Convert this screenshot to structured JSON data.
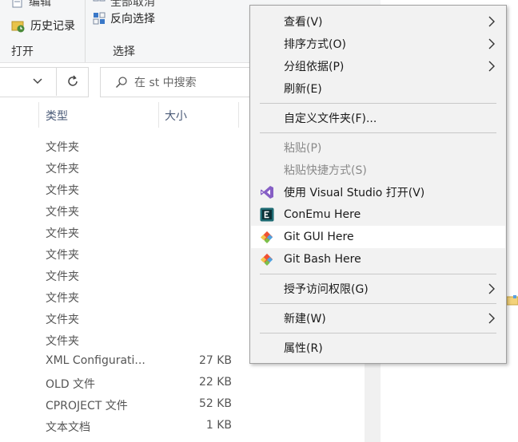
{
  "ribbon": {
    "edit_label": "编辑",
    "history_label": "历史记录",
    "select_none_label": "全部取消",
    "invert_label": "反向选择",
    "group_open": "打开",
    "group_select": "选择"
  },
  "search": {
    "placeholder": "在 st 中搜索"
  },
  "columns": {
    "type": "类型",
    "size": "大小"
  },
  "rows": [
    {
      "type": "文件夹",
      "size": ""
    },
    {
      "type": "文件夹",
      "size": ""
    },
    {
      "type": "文件夹",
      "size": ""
    },
    {
      "type": "文件夹",
      "size": ""
    },
    {
      "type": "文件夹",
      "size": ""
    },
    {
      "type": "文件夹",
      "size": ""
    },
    {
      "type": "文件夹",
      "size": ""
    },
    {
      "type": "文件夹",
      "size": ""
    },
    {
      "type": "文件夹",
      "size": ""
    },
    {
      "type": "文件夹",
      "size": ""
    },
    {
      "type": "XML Configurati...",
      "size": "27 KB"
    },
    {
      "type": "OLD 文件",
      "size": "22 KB"
    },
    {
      "type": "CPROJECT 文件",
      "size": "52 KB"
    },
    {
      "type": "文本文档",
      "size": "1 KB"
    }
  ],
  "menu": {
    "view": "查看(V)",
    "sort": "排序方式(O)",
    "group": "分组依据(P)",
    "refresh": "刷新(E)",
    "customize": "自定义文件夹(F)...",
    "paste": "粘贴(P)",
    "paste_shortcut": "粘贴快捷方式(S)",
    "open_vs": "使用 Visual Studio 打开(V)",
    "conemu": "ConEmu Here",
    "git_gui": "Git GUI Here",
    "git_bash": "Git Bash Here",
    "grant_access": "授予访问权限(G)",
    "new": "新建(W)",
    "properties": "属性(R)"
  },
  "colors": {
    "vs_purple": "#865fc5",
    "conemu_teal": "#1e6b73",
    "git_red": "#f05133",
    "hover_bg": "#ffffff"
  }
}
